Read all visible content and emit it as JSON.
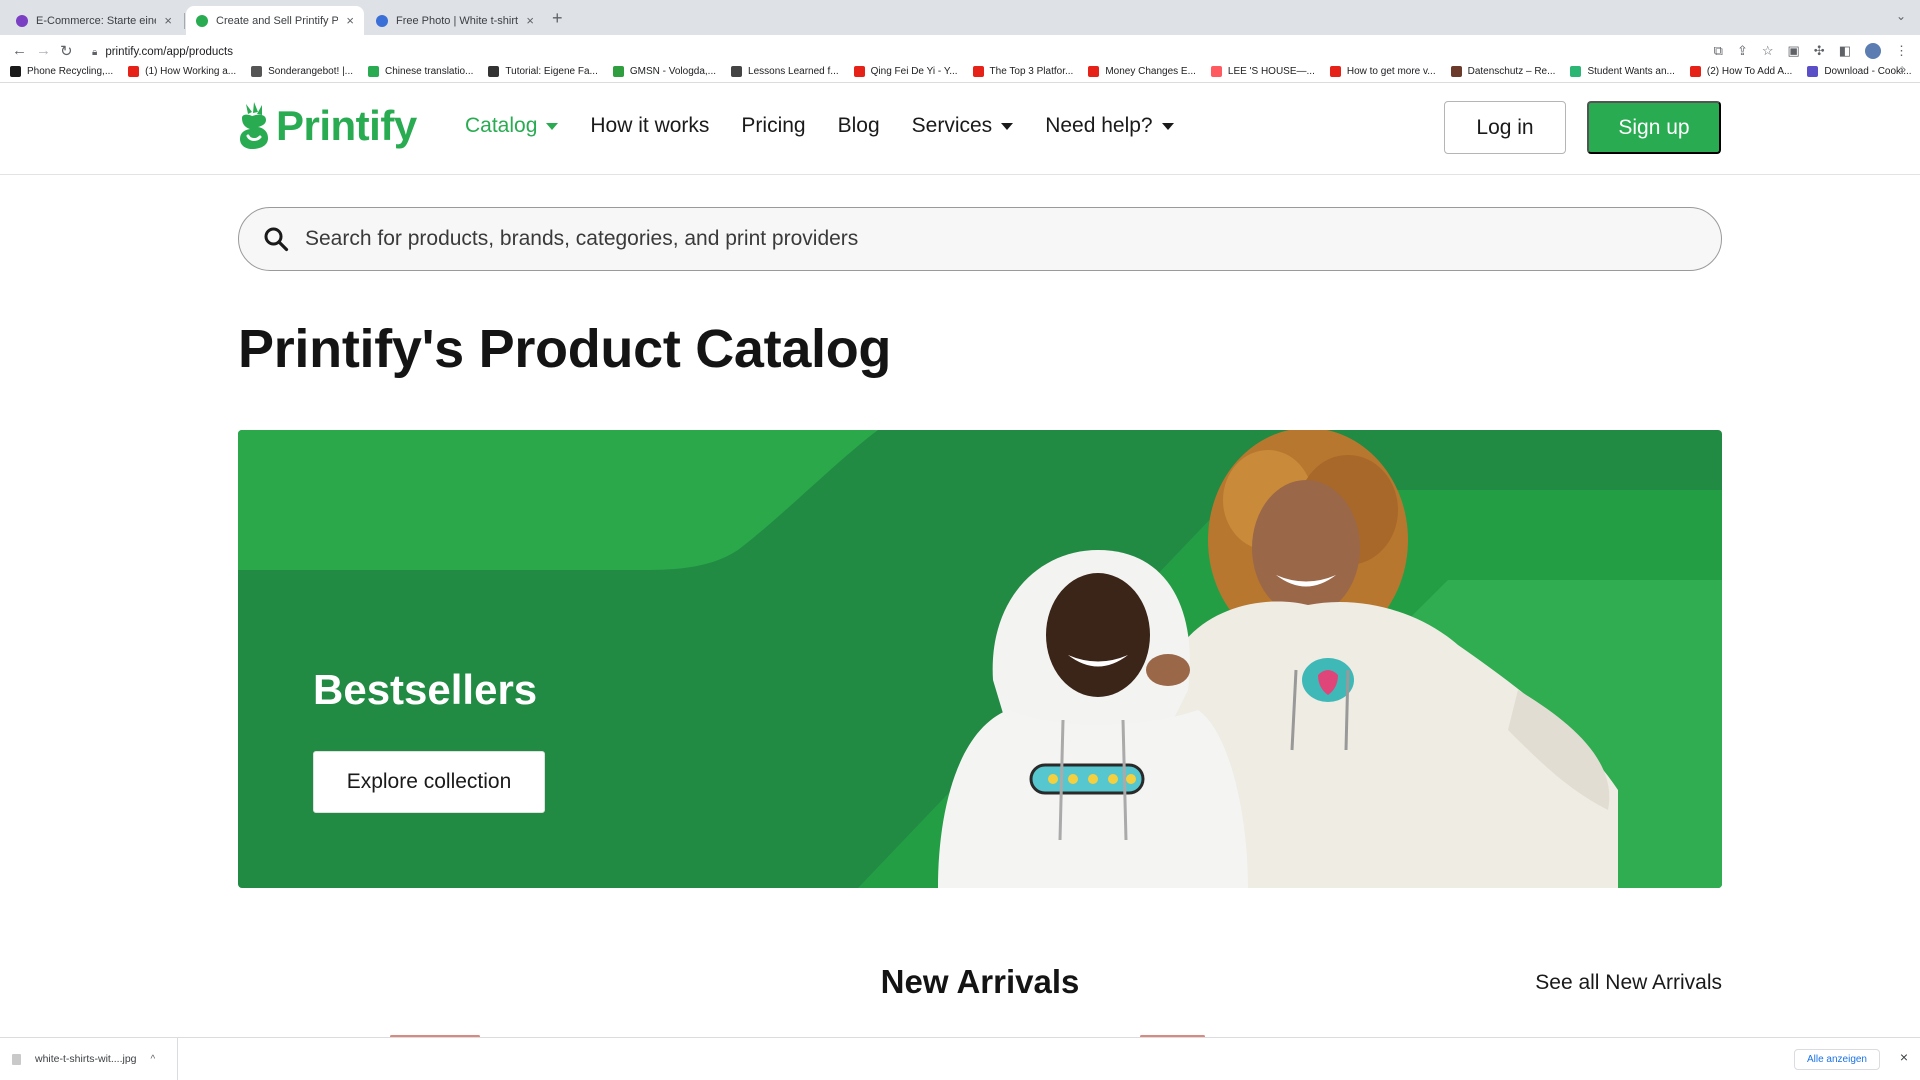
{
  "browser": {
    "tabs": [
      {
        "title": "E-Commerce: Starte eine E-Co",
        "favicon_color": "#7b3fc4",
        "active": false
      },
      {
        "title": "Create and Sell Printify Produc",
        "favicon_color": "#29ab51",
        "active": true
      },
      {
        "title": "Free Photo | White t-shirts wit",
        "favicon_color": "#3b6fd8",
        "active": false
      }
    ],
    "new_tab_label": "+",
    "url": "printify.com/app/products",
    "bookmarks": [
      {
        "label": "Phone Recycling,...",
        "color": "#1a1a1a"
      },
      {
        "label": "(1) How Working a...",
        "color": "#e62117"
      },
      {
        "label": "Sonderangebot! |...",
        "color": "#555555"
      },
      {
        "label": "Chinese translatio...",
        "color": "#29ab51"
      },
      {
        "label": "Tutorial: Eigene Fa...",
        "color": "#333333"
      },
      {
        "label": "GMSN - Vologda,...",
        "color": "#2e9e3e"
      },
      {
        "label": "Lessons Learned f...",
        "color": "#444444"
      },
      {
        "label": "Qing Fei De Yi - Y...",
        "color": "#e62117"
      },
      {
        "label": "The Top 3 Platfor...",
        "color": "#e62117"
      },
      {
        "label": "Money Changes E...",
        "color": "#e62117"
      },
      {
        "label": "LEE 'S HOUSE—...",
        "color": "#ff5a5f"
      },
      {
        "label": "How to get more v...",
        "color": "#e62117"
      },
      {
        "label": "Datenschutz – Re...",
        "color": "#6b3a2a"
      },
      {
        "label": "Student Wants an...",
        "color": "#2bb673"
      },
      {
        "label": "(2) How To Add A...",
        "color": "#e62117"
      },
      {
        "label": "Download - Cooki...",
        "color": "#5b4fc7"
      }
    ],
    "bookmarks_more": "»"
  },
  "header": {
    "logo_text": "Printify",
    "nav": [
      {
        "label": "Catalog",
        "has_caret": true,
        "active": true
      },
      {
        "label": "How it works",
        "has_caret": false,
        "active": false
      },
      {
        "label": "Pricing",
        "has_caret": false,
        "active": false
      },
      {
        "label": "Blog",
        "has_caret": false,
        "active": false
      },
      {
        "label": "Services",
        "has_caret": true,
        "active": false
      },
      {
        "label": "Need help?",
        "has_caret": true,
        "active": false
      }
    ],
    "login_label": "Log in",
    "signup_label": "Sign up"
  },
  "search": {
    "placeholder": "Search for products, brands, categories, and print providers",
    "value": ""
  },
  "page": {
    "title": "Printify's Product Catalog"
  },
  "hero": {
    "title": "Bestsellers",
    "button_label": "Explore collection"
  },
  "new_arrivals": {
    "title": "New Arrivals",
    "link_label": "See all New Arrivals"
  },
  "download_shelf": {
    "file_name": "white-t-shirts-wit....jpg",
    "show_all_label": "Alle anzeigen",
    "close_label": "×"
  },
  "colors": {
    "brand_green": "#29ab51",
    "hero_dark": "#218a43",
    "hero_light": "#2aa84a"
  }
}
